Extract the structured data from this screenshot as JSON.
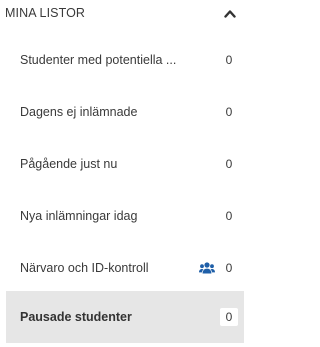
{
  "header": {
    "title": "MINA LISTOR"
  },
  "list": {
    "items": [
      {
        "label": "Studenter med potentiella ...",
        "count": "0"
      },
      {
        "label": "Dagens ej inlämnade",
        "count": "0"
      },
      {
        "label": "Pågående just nu",
        "count": "0"
      },
      {
        "label": "Nya inlämningar idag",
        "count": "0"
      },
      {
        "label": "Närvaro och ID-kontroll",
        "count": "0",
        "icon": "users-icon"
      },
      {
        "label": "Pausade studenter",
        "count": "0",
        "active": true
      }
    ]
  },
  "colors": {
    "accent_icon": "#1f5fa8",
    "active_bg": "#e6e6e6"
  }
}
